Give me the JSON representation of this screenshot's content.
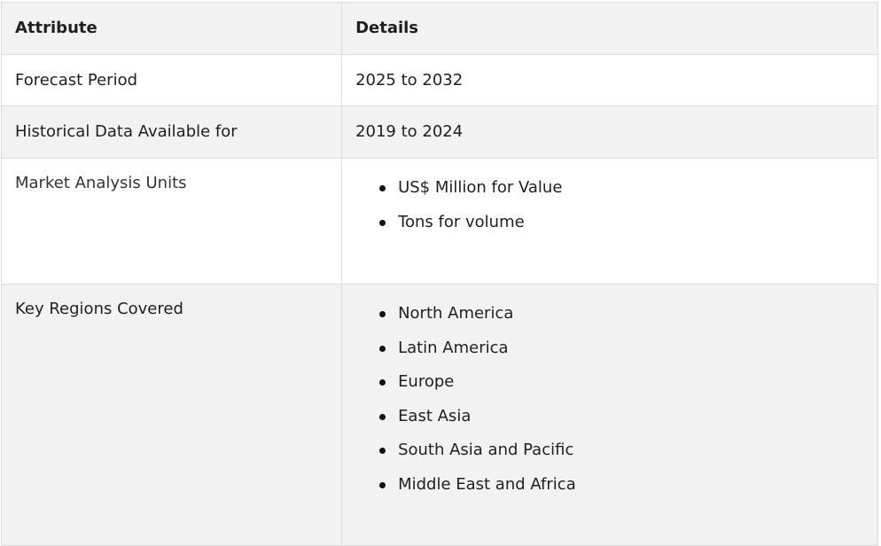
{
  "table": {
    "header": {
      "attribute": "Attribute",
      "details": "Details"
    },
    "rows": [
      {
        "attribute": "Forecast Period",
        "details": "2025 to 2032"
      },
      {
        "attribute": "Historical Data Available for",
        "details": "2019 to 2024"
      },
      {
        "attribute": "Market Analysis Units",
        "details_list": [
          "US$ Million for Value",
          "Tons for volume"
        ]
      },
      {
        "attribute": "Key Regions Covered",
        "details_list": [
          "North America",
          "Latin America",
          "Europe",
          "East Asia",
          "South Asia and Pacific",
          "Middle East and Africa"
        ]
      }
    ]
  }
}
